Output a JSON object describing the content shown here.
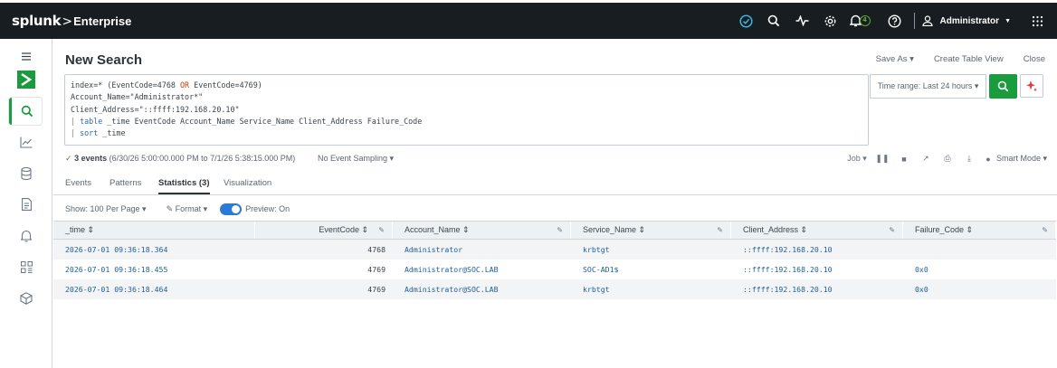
{
  "app": {
    "brand_logo": "splunk",
    "brand_chevron": ">",
    "brand_product": "Enterprise",
    "notification_count": "4",
    "user_name": "Administrator",
    "accent_color": "#1a9c3e"
  },
  "page": {
    "title": "New Search",
    "actions": [
      "Save As ▾",
      "Create Table View",
      "Close"
    ]
  },
  "search": {
    "line1_prefix": "index=* (EventCode=4768 ",
    "line1_or": "OR",
    "line1_suffix": " EventCode=4769)",
    "line2": "Account_Name=\"Administrator*\"",
    "line3": "Client_Address=\"::ffff:192.168.20.10\"",
    "line4_pipe": "| ",
    "line4_cmd": "table",
    "line4_args": " _time EventCode Account_Name Service_Name Client_Address Failure_Code",
    "line5_pipe": "| ",
    "line5_cmd": "sort",
    "line5_args": " _time",
    "time_range": "Time range: Last 24 hours ▾"
  },
  "status": {
    "events": "3 events",
    "range": " (6/30/26 5:00:00.000 PM to 7/1/26 5:38:15.000 PM)",
    "sampling": "No Event Sampling ▾",
    "job": "Job ▾",
    "mode": "Smart Mode ▾"
  },
  "tabs": [
    "Events",
    "Patterns",
    "Statistics (3)",
    "Visualization"
  ],
  "controls": {
    "per_page": "Show: 100 Per Page ▾",
    "format": "Format ▾",
    "preview": "Preview: On"
  },
  "table": {
    "columns": [
      "_time ⇕",
      "EventCode ⇕",
      "Account_Name ⇕",
      "Service_Name ⇕",
      "Client_Address ⇕",
      "Failure_Code ⇕"
    ],
    "rows": [
      [
        "2026-07-01 09:36:18.364",
        "4768",
        "Administrator",
        "krbtgt",
        "::ffff:192.168.20.10",
        ""
      ],
      [
        "2026-07-01 09:36:18.455",
        "4769",
        "Administrator@SOC.LAB",
        "SOC-AD1$",
        "::ffff:192.168.20.10",
        "0x0"
      ],
      [
        "2026-07-01 09:36:18.464",
        "4769",
        "Administrator@SOC.LAB",
        "krbtgt",
        "::ffff:192.168.20.10",
        "0x0"
      ]
    ]
  }
}
